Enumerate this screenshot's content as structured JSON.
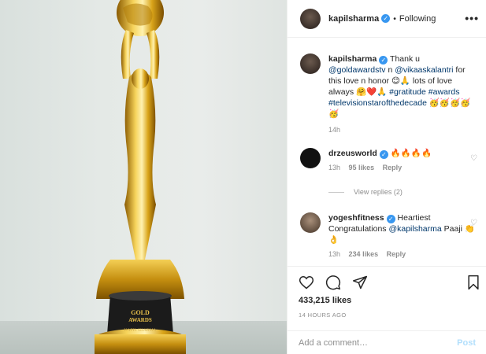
{
  "header": {
    "username": "kapilsharma",
    "dot": "•",
    "follow_status": "Following",
    "more": "•••"
  },
  "caption": {
    "username": "kapilsharma",
    "text_1": "Thank u",
    "mention_1": "@goldawardstv",
    "text_2": "n",
    "mention_2": "@vikaaskalantri",
    "text_3": "for this love n honor 😊🙏 lots of love always 🤗❤️🙏",
    "hashtag_1": "#gratitude",
    "hashtag_2": "#awards",
    "hashtag_3": "#televisionstarofthedecade",
    "emoji_tail": "🥳🥳🥳🥳🥳",
    "time": "14h"
  },
  "comments": [
    {
      "username": "drzeusworld",
      "text": "🔥🔥🔥🔥",
      "time": "13h",
      "likes": "95 likes",
      "reply": "Reply",
      "view_replies": "View replies (2)"
    },
    {
      "username": "yogeshfitness",
      "text_1": "Heartiest Congratulations",
      "mention": "@kapilsharma",
      "text_2": "Paaji 👏👌",
      "time": "13h",
      "likes": "234 likes",
      "reply": "Reply"
    }
  ],
  "actions": {
    "likes": "433,215 likes",
    "timestamp": "14 HOURS AGO"
  },
  "add_comment": {
    "placeholder": "Add a comment…",
    "post_label": "Post"
  },
  "trophy_plaque": {
    "line_1": "GOLD",
    "line_2": "AWARDS",
    "line_3": "KAPIL SHARMA"
  },
  "colors": {
    "link": "#00376b",
    "verified": "#3897f0",
    "muted": "#8e8e8e",
    "post_disabled": "#b2dffc",
    "gold": "#d4a20c"
  }
}
